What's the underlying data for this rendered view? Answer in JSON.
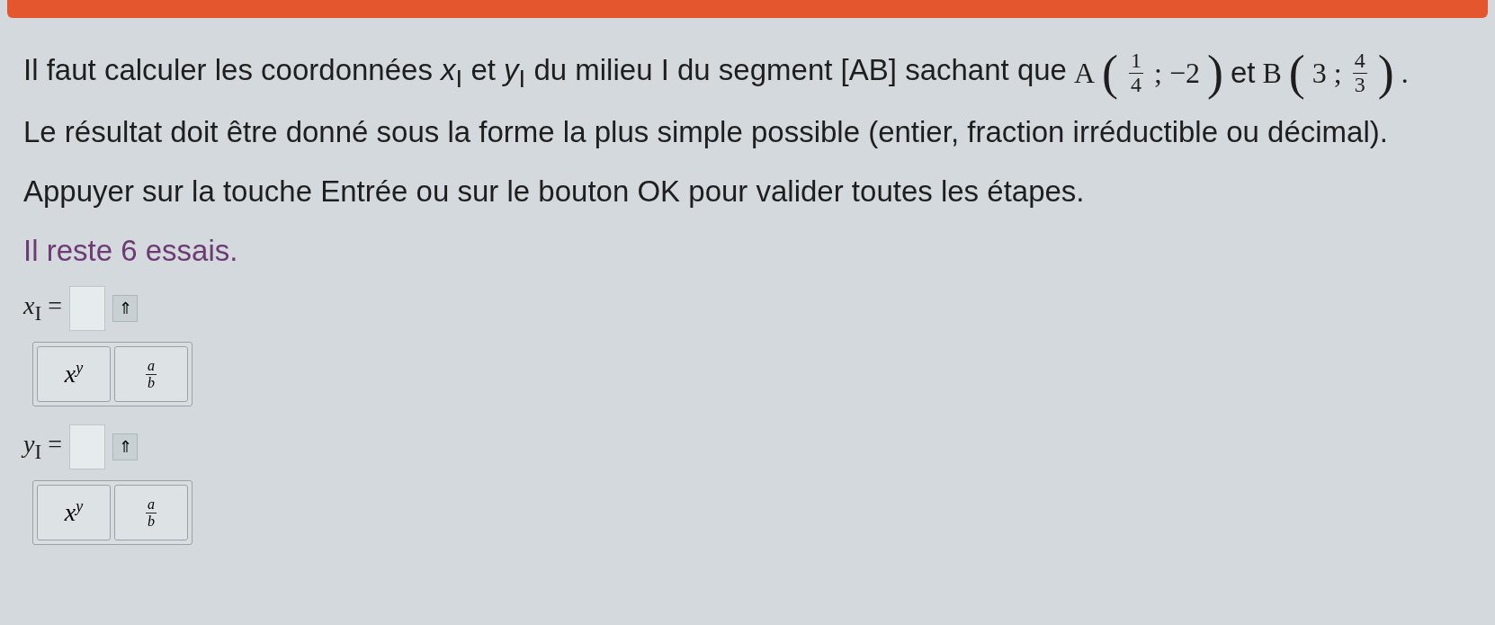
{
  "intro": {
    "text": "Il faut calculer les coordonnées *x*$_{I}$ et *y*$_{I}$ du milieu I du segment [AB] sachant que",
    "points": [
      {
        "name": "A",
        "open": "(",
        "close": ")",
        "sep": ";",
        "coords": [
          {
            "kind": "fraction",
            "num": "1",
            "den": "4"
          },
          {
            "kind": "text",
            "text": "−2"
          }
        ]
      },
      {
        "name": "B",
        "open": "(",
        "close": ")",
        "sep": ";",
        "coords": [
          {
            "kind": "text",
            "text": "3"
          },
          {
            "kind": "fraction",
            "num": "4",
            "den": "3"
          }
        ]
      }
    ],
    "joiner": "et",
    "end": "."
  },
  "instructions": [
    "Le résultat doit être donné sous la forme la plus simple possible (entier, fraction irréductible ou décimal).",
    "Appuyer sur la touche Entrée ou sur le bouton OK pour valider toutes les étapes."
  ],
  "attempts": "Il reste 6 essais.",
  "answers": [
    {
      "label": "*x*$_{I}$ =",
      "toggle": "⇑",
      "keys": [
        {
          "kind": "power",
          "base": "x",
          "exp": "y"
        },
        {
          "kind": "fraction",
          "num": "a",
          "den": "b"
        }
      ]
    },
    {
      "label": "*y*$_{I}$ =",
      "toggle": "⇑",
      "keys": [
        {
          "kind": "power",
          "base": "x",
          "exp": "y"
        },
        {
          "kind": "fraction",
          "num": "a",
          "den": "b"
        }
      ]
    }
  ]
}
